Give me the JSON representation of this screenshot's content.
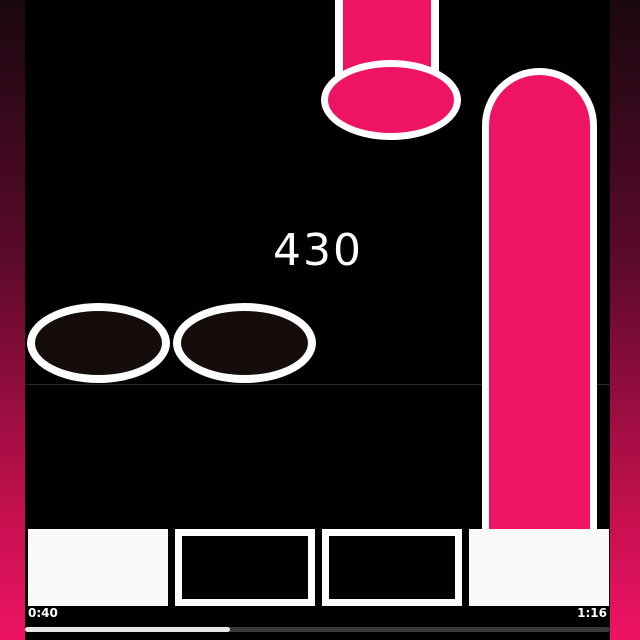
{
  "game": {
    "score": "430",
    "lanes": 4,
    "active_pads": [
      1,
      4
    ]
  },
  "playback": {
    "elapsed": "0:40",
    "total": "1:16",
    "progress": 0.35
  },
  "colors": {
    "note_pink": "#ee1463",
    "note_outline": "#ffffff",
    "tap_note_fill": "#150c0c",
    "background": "#000000"
  }
}
